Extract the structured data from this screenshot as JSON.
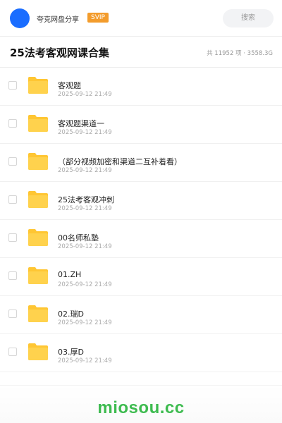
{
  "header": {
    "username": "夸克网盘分享",
    "badge": "SVIP",
    "search_placeholder": "搜索"
  },
  "share": {
    "title": "25法考客观网课合集",
    "stats": "共 11952 项 · 3558.3G"
  },
  "files": [
    {
      "name": "客观题",
      "date": "2025-09-12 21:49",
      "icon": "folder-icon"
    },
    {
      "name": "客观题渠道一",
      "date": "2025-09-12 21:49",
      "icon": "folder-icon"
    },
    {
      "name": "（部分视频加密和渠道二互补着看）",
      "date": "2025-09-12 21:49",
      "icon": "folder-icon"
    },
    {
      "name": "25法考客观冲刺",
      "date": "2025-09-12 21:49",
      "icon": "folder-icon"
    },
    {
      "name": "00名师私塾",
      "date": "2025-09-12 21:49",
      "icon": "folder-icon"
    },
    {
      "name": "01.ZH",
      "date": "2025-09-12 21:49",
      "icon": "folder-icon"
    },
    {
      "name": "02.瑞D",
      "date": "2025-09-12 21:49",
      "icon": "folder-icon"
    },
    {
      "name": "03.厚D",
      "date": "2025-09-12 21:49",
      "icon": "folder-icon"
    }
  ],
  "footer": {
    "watermark": "miosou.cc"
  },
  "colors": {
    "avatar": "#1a6dff",
    "badge": "#f39c2c",
    "folder": "#ffc633",
    "watermark": "#3dbb4f"
  }
}
